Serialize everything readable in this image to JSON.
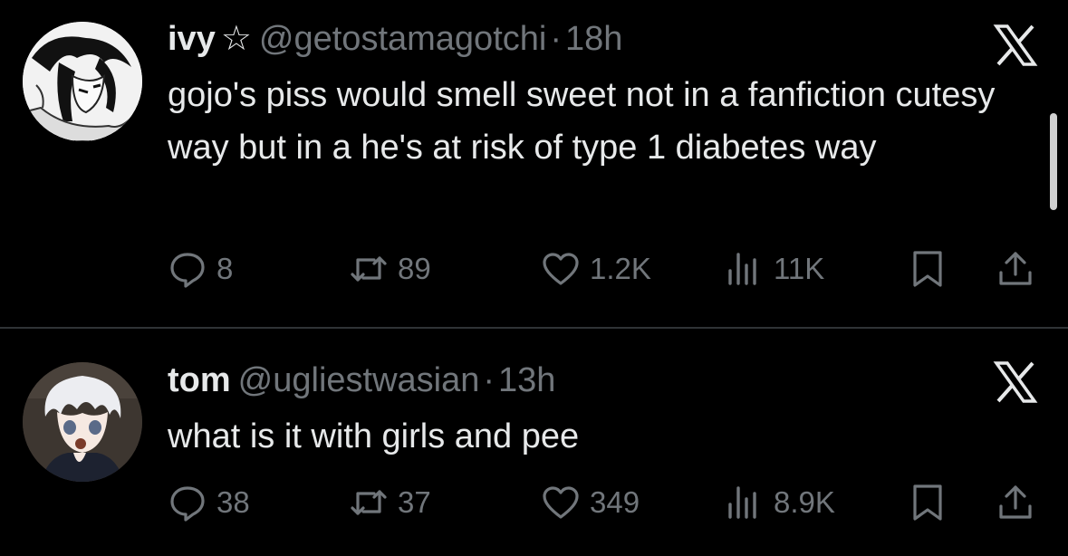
{
  "tweets": [
    {
      "name": "ivy",
      "star": "☆",
      "handle": "@getostamagotchi",
      "separator": "·",
      "time": "18h",
      "text": "gojo's piss would smell sweet not in a fanfiction cutesy way but in a he's at risk of type 1 diabetes way",
      "replies": "8",
      "reposts": "89",
      "likes": "1.2K",
      "views": "11K"
    },
    {
      "name": "tom",
      "handle": "@ugliestwasian",
      "separator": "·",
      "time": "13h",
      "text": "what is it with girls and pee",
      "replies": "38",
      "reposts": "37",
      "likes": "349",
      "views": "8.9K"
    }
  ],
  "icons": {
    "logo": "x-logo-icon",
    "reply": "reply-icon",
    "repost": "repost-icon",
    "like": "heart-icon",
    "views": "views-icon",
    "bookmark": "bookmark-icon",
    "share": "share-icon"
  },
  "colors": {
    "background": "#000000",
    "primary_text": "#e7e9ea",
    "secondary_text": "#71767b",
    "divider": "#2f3336"
  }
}
